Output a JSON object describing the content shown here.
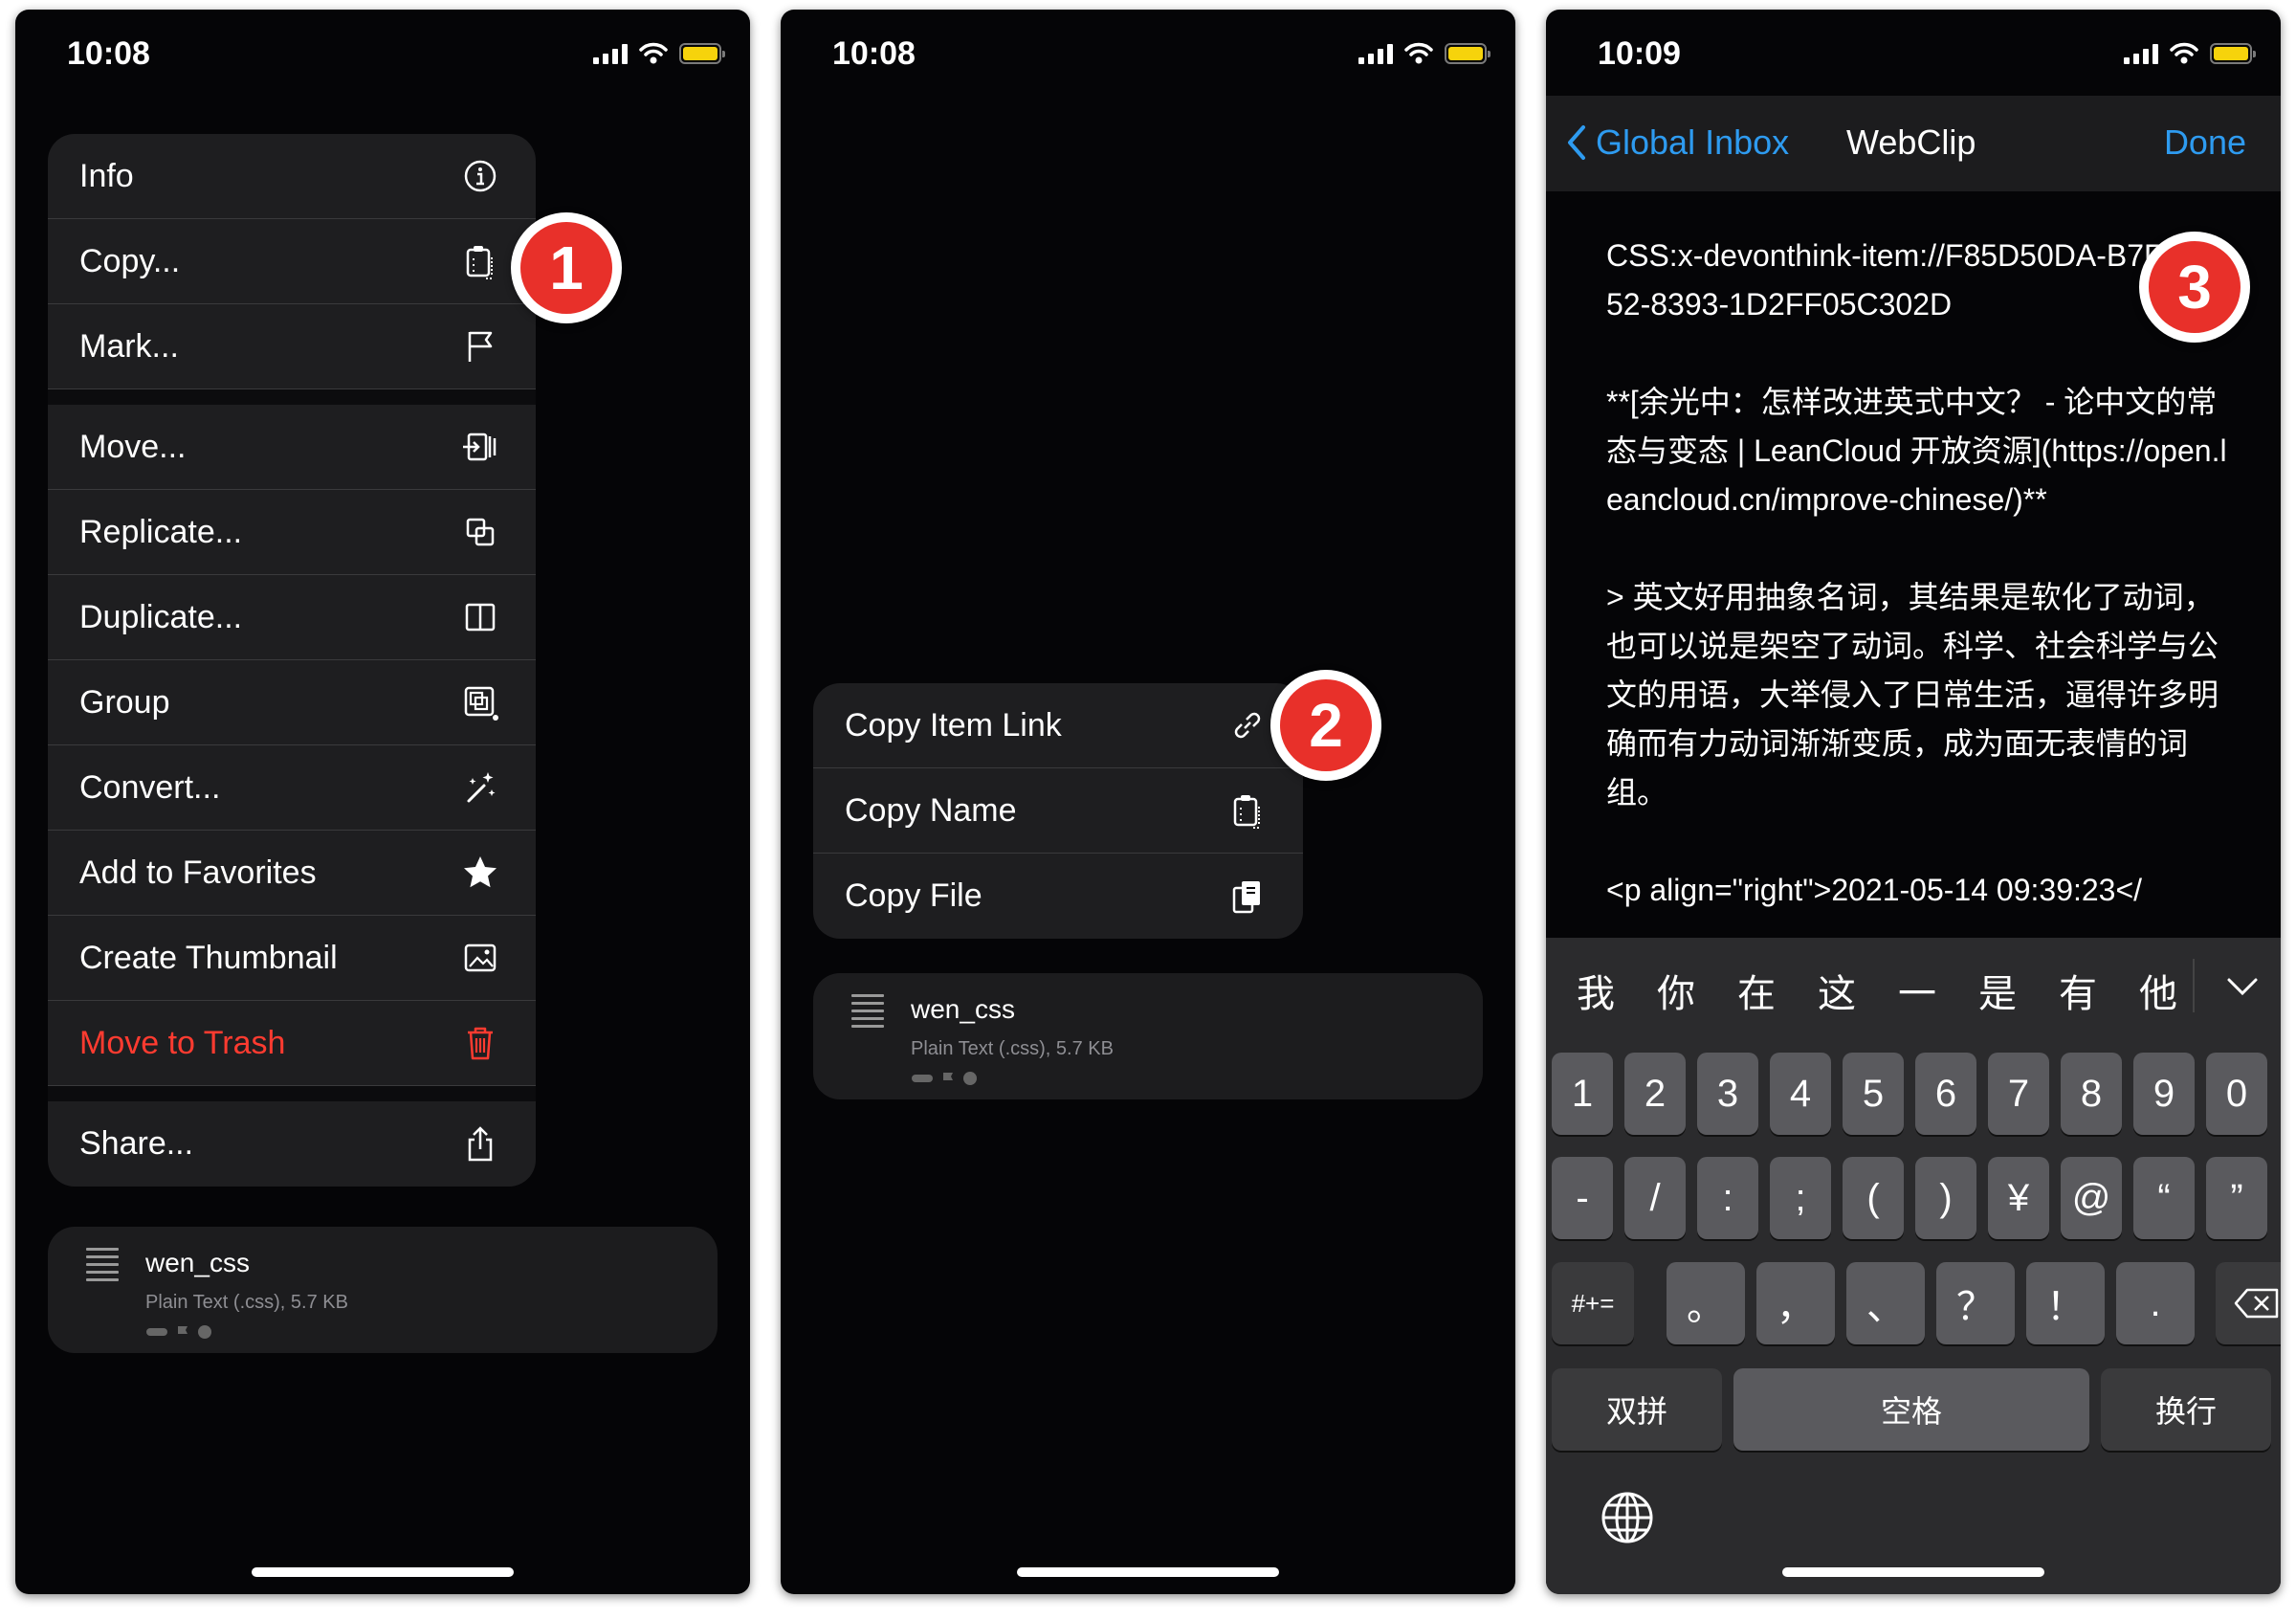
{
  "status_bars": [
    {
      "time": "10:08"
    },
    {
      "time": "10:08"
    },
    {
      "time": "10:09"
    }
  ],
  "context_menu": {
    "items": [
      {
        "label": "Info",
        "icon": "info-icon"
      },
      {
        "label": "Copy...",
        "icon": "clipboard-icon"
      },
      {
        "label": "Mark...",
        "icon": "flag-icon"
      },
      {
        "label": "Move...",
        "icon": "move-icon"
      },
      {
        "label": "Replicate...",
        "icon": "replicate-icon"
      },
      {
        "label": "Duplicate...",
        "icon": "duplicate-icon"
      },
      {
        "label": "Group",
        "icon": "group-icon"
      },
      {
        "label": "Convert...",
        "icon": "magic-wand-icon"
      },
      {
        "label": "Add to Favorites",
        "icon": "star-icon"
      },
      {
        "label": "Create Thumbnail",
        "icon": "photo-icon"
      },
      {
        "label": "Move to Trash",
        "icon": "trash-icon"
      },
      {
        "label": "Share...",
        "icon": "share-icon"
      }
    ],
    "danger_color": "#ff3b30"
  },
  "copy_submenu": {
    "items": [
      {
        "label": "Copy Item Link",
        "icon": "link-icon"
      },
      {
        "label": "Copy Name",
        "icon": "clipboard-icon"
      },
      {
        "label": "Copy File",
        "icon": "copy-file-icon"
      }
    ]
  },
  "file_card": {
    "name": "wen_css",
    "info": "Plain Text (.css), 5.7 KB"
  },
  "badges": [
    "1",
    "2",
    "3"
  ],
  "editor_screen": {
    "back_label": "Global Inbox",
    "title": "WebClip",
    "done_label": "Done",
    "accent_color": "#2e9bf0",
    "content": "CSS:x-devonthink-item://F85D50DA-B7F7-4152-8393-1D2FF05C302D\n\n**[余光中：怎样改进英式中文？ - 论中文的常态与变态 | LeanCloud 开放资源](https://open.leancloud.cn/improve-chinese/)**\n\n> 英文好用抽象名词，其结果是软化了动词，也可以说是架空了动词。科学、社会科学与公文的用语，大举侵入了日常生活，逼得许多明确而有力动词渐渐变质，成为面无表情的词组。\n\n<p align=\"right\">2021-05-14 09:39:23</"
  },
  "keyboard": {
    "candidates": [
      "我",
      "你",
      "在",
      "这",
      "一",
      "是",
      "有",
      "他"
    ],
    "row1": [
      "1",
      "2",
      "3",
      "4",
      "5",
      "6",
      "7",
      "8",
      "9",
      "0"
    ],
    "row2": [
      "-",
      "/",
      ":",
      ";",
      "(",
      ")",
      "¥",
      "@",
      "“",
      "”"
    ],
    "row3_mode": "#+=",
    "row3": [
      "。",
      "，",
      "、",
      "？",
      "！",
      "."
    ],
    "bottom_left": "双拼",
    "space": "空格",
    "return": "换行"
  }
}
